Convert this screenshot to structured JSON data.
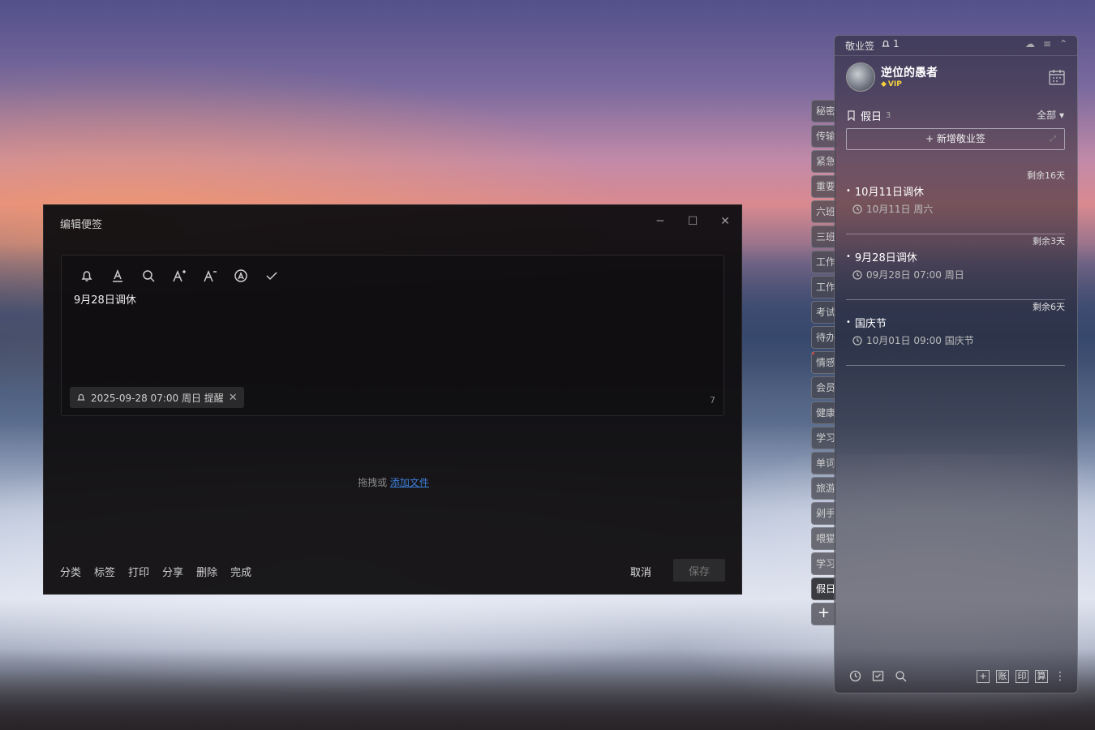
{
  "dialog": {
    "title": "编辑便签",
    "controls": [
      "─",
      "☐",
      "✕"
    ],
    "toolbar": [
      "bell",
      "text-color",
      "search",
      "font-increase",
      "font-decrease",
      "font-style",
      "check"
    ],
    "note_text": "9月28日调休",
    "reminder": "2025-09-28 07:00 周日 提醒",
    "char_count": "7",
    "drop_text": "拖拽或",
    "drop_link": "添加文件",
    "actions": [
      "分类",
      "标签",
      "打印",
      "分享",
      "删除",
      "完成"
    ],
    "cancel": "取消",
    "save": "保存"
  },
  "tabs": [
    "秘密",
    "传输",
    "紧急",
    "重要",
    "六班",
    "三班",
    "工作",
    "工作",
    "考试",
    "待办",
    "情感",
    "会员",
    "健康",
    "学习",
    "单词",
    "旅游",
    "剁手",
    "喂猫",
    "学习",
    "假日"
  ],
  "tab_add": "+",
  "panel": {
    "app_name": "敬业签",
    "bell_count": "1",
    "user_name": "逆位的愚者",
    "vip": "VIP",
    "category": "假日",
    "category_count": "3",
    "filter": "全部 ▾",
    "new_button": "+ 新增敬业签",
    "notes": [
      {
        "remain": "剩余16天",
        "title": "10月11日调休",
        "date": "10月11日 周六"
      },
      {
        "remain": "剩余3天",
        "title": "9月28日调休",
        "date": "09月28日 07:00 周日"
      },
      {
        "remain": "剩余6天",
        "title": "国庆节",
        "date": "10月01日 09:00 国庆节"
      }
    ],
    "bottom_right": [
      "+",
      "账",
      "印",
      "算"
    ]
  }
}
